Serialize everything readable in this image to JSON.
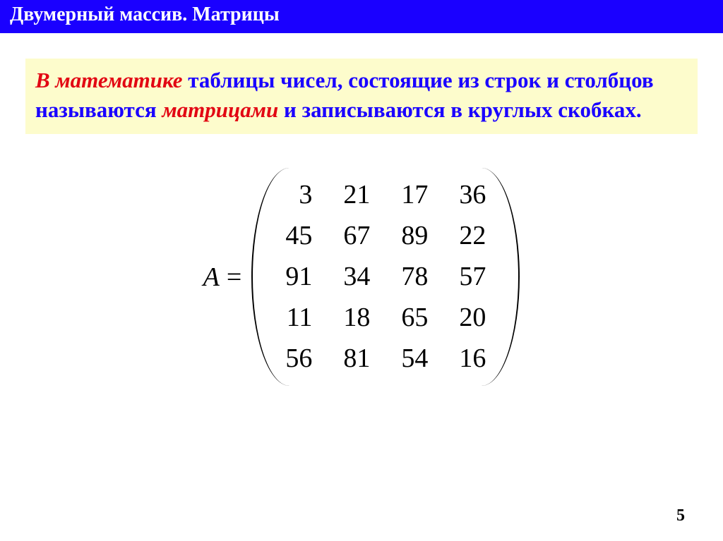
{
  "header": {
    "title": "Двумерный массив. Матрицы"
  },
  "definition": {
    "part1_em": "В математике",
    "part2": " таблицы чисел, состоящие из строк и столбцов называются ",
    "part3_em": "матрицами",
    "part4": " и записываются в круглых скобках."
  },
  "matrix": {
    "label": "A",
    "equals": "=",
    "rows": [
      [
        "3",
        "21",
        "17",
        "36"
      ],
      [
        "45",
        "67",
        "89",
        "22"
      ],
      [
        "91",
        "34",
        "78",
        "57"
      ],
      [
        "11",
        "18",
        "65",
        "20"
      ],
      [
        "56",
        "81",
        "54",
        "16"
      ]
    ]
  },
  "page_number": "5"
}
